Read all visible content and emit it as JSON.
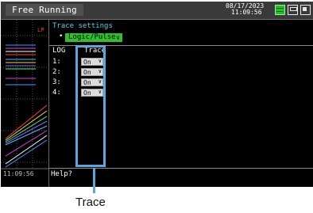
{
  "header": {
    "mode": "Free Running",
    "date": "08/17/2023",
    "time": "11:09:56"
  },
  "waveform": {
    "filter_label": "LP",
    "time_label": "11:09:56"
  },
  "settings": {
    "section_title": "Trace settings",
    "bullet": "•",
    "mode_value": "Logic/Pulse",
    "col_log": "LOG",
    "col_trace": "Trace",
    "rows": [
      {
        "label": "1:",
        "value": "On"
      },
      {
        "label": "2:",
        "value": "On"
      },
      {
        "label": "3:",
        "value": "On"
      },
      {
        "label": "4:",
        "value": "On"
      }
    ],
    "help": "Help?"
  },
  "callout": {
    "label": "Trace"
  },
  "icons": {
    "dropdown_arrow": "chevron-down-icon",
    "status": [
      "battery-icon",
      "memory-card-icon",
      "pc-connection-icon",
      "extra-status-icon"
    ]
  },
  "colors": {
    "accent_cyan": "#4ed3e8",
    "dropdown_green": "#2fbf2f",
    "highlight_blue": "#5aa7e0",
    "lp_red": "#ff3030"
  }
}
